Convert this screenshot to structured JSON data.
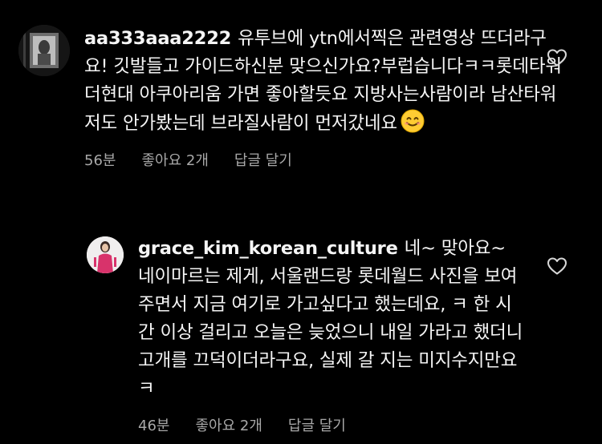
{
  "comments": [
    {
      "username": "aa333aaa2222",
      "text": "유투브에 ytn에서찍은 관련영상 뜨더라구요! 깃발들고 가이드하신분 맞으신가요?부럽습니다ㅋㅋ롯데타워 더현대 아쿠아리움 가면 좋아할듯요 지방사는사람이라 남산타워저도 안가봤는데 브라질사람이 먼저갔네요",
      "emoji_icon": "smiling-face-emoji",
      "time": "56분",
      "likes": "좋아요 2개",
      "reply_label": "답글 달기",
      "like_icon": "heart-outline-icon"
    },
    {
      "username": "grace_kim_korean_culture",
      "text": "네~ 맞아요~ 네이마르는 제게, 서울랜드랑 롯데월드 사진을 보여주면서 지금 여기로 가고싶다고 했는데요, ㅋ 한 시간 이상 걸리고 오늘은 늦었으니 내일 가라고 했더니 고개를 끄덕이더라구요, 실제 갈 지는 미지수지만요 ㅋ",
      "time": "46분",
      "likes": "좋아요 2개",
      "reply_label": "답글 달기",
      "like_icon": "heart-outline-icon"
    }
  ],
  "colors": {
    "background": "#000000",
    "text": "#f5f5f5",
    "meta": "#a8a8a8",
    "avatar2_dress": "#d8336b"
  }
}
